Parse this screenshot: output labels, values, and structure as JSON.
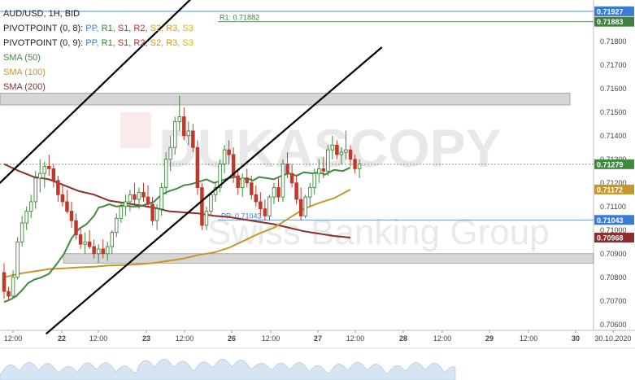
{
  "chart_data": {
    "type": "candlestick",
    "title": "AUD/USD, 1H, BID",
    "y_axis": {
      "ylim": [
        0.70575,
        0.71975
      ],
      "ticks": [
        "0.71800",
        "0.71700",
        "0.71600",
        "0.71500",
        "0.71400",
        "0.71300",
        "0.71200",
        "0.71100",
        "0.71000",
        "0.70900",
        "0.70800",
        "0.70700",
        "0.70600"
      ],
      "position": "right"
    },
    "x_axis": {
      "tick_labels": [
        "12:00",
        "22",
        "12:00",
        "23",
        "12:00",
        "26",
        "12:00",
        "27",
        "12:00",
        "28",
        "12:00",
        "29",
        "12:00",
        "30",
        "30.10.2020"
      ]
    },
    "legend": [
      {
        "text": "AUD/USD, 1H, BID",
        "color": "#222222"
      },
      {
        "prefix": "PIVOTPOINT (0, 8):",
        "items": [
          "PP",
          "R1",
          "S1",
          "R2",
          "S2",
          "R3",
          "S3"
        ],
        "colors": [
          "#3a7bd5",
          "#2e8b2e",
          "#c62828",
          "#c62828",
          "#d79a00",
          "#d79a00",
          "#e0b800"
        ]
      },
      {
        "prefix": "PIVOTPOINT (0, 9):",
        "items": [
          "PP",
          "R1",
          "S1",
          "R2",
          "S2",
          "R3",
          "S3"
        ],
        "colors": [
          "#3a7bd5",
          "#2e8b2e",
          "#c62828",
          "#c62828",
          "#d79a00",
          "#d79a00",
          "#e0b800"
        ]
      },
      {
        "text": "SMA (50)",
        "color": "#3f8a3f"
      },
      {
        "text": "SMA (100)",
        "color": "#c9962a"
      },
      {
        "text": "SMA (200)",
        "color": "#8e2d2d"
      }
    ],
    "levels": [
      {
        "name": "R1",
        "label": "R1: 0.71882",
        "value": 0.71883,
        "badge": "0.71883",
        "color": "#3f7f3f"
      },
      {
        "name": "top",
        "value": 0.71927,
        "badge": "0.71927",
        "color": "#3a7bd5"
      },
      {
        "name": "PP",
        "label": "PP: 0.71043",
        "value": 0.71043,
        "badge": "0.71043",
        "color": "#3a7bd5"
      }
    ],
    "last_price": {
      "value": 0.71279,
      "badge": "0.71279",
      "color": "#3f8a3f"
    },
    "sma100_last": {
      "value": 0.71172,
      "badge": "0.71172",
      "color": "#c9962a"
    },
    "sma200_last": {
      "value": 0.70968,
      "badge": "0.70968",
      "color": "#8e2d2d"
    },
    "zones": [
      {
        "from": 0.7153,
        "to": 0.7158,
        "color": "#cfcfcf"
      },
      {
        "from": 0.7086,
        "to": 0.709,
        "color": "#cfcfcf"
      }
    ],
    "trendlines": [
      {
        "from": [
          -6,
          0.7118
        ],
        "to": [
          128,
          0.72
        ]
      },
      {
        "from": [
          28,
          0.7056
        ],
        "to": [
          252,
          0.71775
        ]
      }
    ],
    "sma50": [
      [
        0,
        0.70695
      ],
      [
        4,
        0.70705
      ],
      [
        8,
        0.7072
      ],
      [
        12,
        0.70745
      ],
      [
        16,
        0.70775
      ],
      [
        20,
        0.7079
      ],
      [
        25,
        0.708
      ],
      [
        30,
        0.70815
      ],
      [
        35,
        0.70855
      ],
      [
        40,
        0.709
      ],
      [
        45,
        0.70965
      ],
      [
        50,
        0.71005
      ],
      [
        55,
        0.71025
      ],
      [
        60,
        0.7106
      ],
      [
        63,
        0.71095
      ],
      [
        66,
        0.711
      ],
      [
        70,
        0.7111
      ],
      [
        75,
        0.711
      ],
      [
        80,
        0.71105
      ],
      [
        85,
        0.711
      ],
      [
        90,
        0.711
      ],
      [
        95,
        0.7111
      ],
      [
        100,
        0.7112
      ],
      [
        105,
        0.7115
      ],
      [
        110,
        0.71165
      ],
      [
        115,
        0.71175
      ],
      [
        120,
        0.7119
      ],
      [
        125,
        0.71195
      ],
      [
        130,
        0.71205
      ],
      [
        135,
        0.71215
      ],
      [
        140,
        0.712
      ],
      [
        145,
        0.7121
      ],
      [
        150,
        0.7122
      ],
      [
        154,
        0.71225
      ],
      [
        158,
        0.71215
      ],
      [
        162,
        0.7122
      ],
      [
        166,
        0.7121
      ],
      [
        170,
        0.71225
      ],
      [
        175,
        0.7122
      ],
      [
        180,
        0.71215
      ],
      [
        185,
        0.7123
      ],
      [
        190,
        0.7124
      ],
      [
        195,
        0.7123
      ],
      [
        200,
        0.71245
      ],
      [
        206,
        0.7124
      ],
      [
        210,
        0.71245
      ],
      [
        214,
        0.71235
      ],
      [
        220,
        0.71255
      ],
      [
        226,
        0.7125
      ],
      [
        231,
        0.71265
      ]
    ],
    "sma100": [
      [
        0,
        0.708
      ],
      [
        10,
        0.70815
      ],
      [
        20,
        0.70825
      ],
      [
        30,
        0.70835
      ],
      [
        40,
        0.70838
      ],
      [
        50,
        0.70842
      ],
      [
        60,
        0.70845
      ],
      [
        70,
        0.7085
      ],
      [
        80,
        0.70852
      ],
      [
        90,
        0.70855
      ],
      [
        100,
        0.7086
      ],
      [
        110,
        0.7087
      ],
      [
        120,
        0.7088
      ],
      [
        130,
        0.70895
      ],
      [
        140,
        0.70905
      ],
      [
        150,
        0.70925
      ],
      [
        160,
        0.70955
      ],
      [
        170,
        0.70985
      ],
      [
        180,
        0.7101
      ],
      [
        190,
        0.7105
      ],
      [
        200,
        0.7109
      ],
      [
        210,
        0.71115
      ],
      [
        220,
        0.71135
      ],
      [
        231,
        0.71172
      ]
    ],
    "sma200": [
      [
        0,
        0.7128
      ],
      [
        10,
        0.7125
      ],
      [
        20,
        0.71225
      ],
      [
        30,
        0.71215
      ],
      [
        40,
        0.7119
      ],
      [
        50,
        0.71165
      ],
      [
        60,
        0.7115
      ],
      [
        70,
        0.71125
      ],
      [
        80,
        0.71115
      ],
      [
        90,
        0.71105
      ],
      [
        100,
        0.71095
      ],
      [
        110,
        0.7108
      ],
      [
        120,
        0.71075
      ],
      [
        130,
        0.7107
      ],
      [
        140,
        0.7106
      ],
      [
        150,
        0.71055
      ],
      [
        160,
        0.71045
      ],
      [
        170,
        0.71035
      ],
      [
        180,
        0.71025
      ],
      [
        190,
        0.7101
      ],
      [
        200,
        0.70995
      ],
      [
        210,
        0.70985
      ],
      [
        220,
        0.70975
      ],
      [
        231,
        0.70968
      ]
    ],
    "candles": [
      [
        0.7082,
        0.7086,
        0.7071,
        0.7074
      ],
      [
        0.7074,
        0.7076,
        0.707,
        0.7072
      ],
      [
        0.7072,
        0.7083,
        0.7071,
        0.708
      ],
      [
        0.708,
        0.7097,
        0.7079,
        0.7095
      ],
      [
        0.7095,
        0.7106,
        0.7093,
        0.7103
      ],
      [
        0.7103,
        0.711,
        0.71,
        0.7108
      ],
      [
        0.7108,
        0.7115,
        0.7105,
        0.7112
      ],
      [
        0.7112,
        0.7125,
        0.7109,
        0.7122
      ],
      [
        0.7122,
        0.713,
        0.7116,
        0.7124
      ],
      [
        0.7124,
        0.7129,
        0.7118,
        0.7127
      ],
      [
        0.7127,
        0.7132,
        0.7123,
        0.7126
      ],
      [
        0.7126,
        0.7128,
        0.7118,
        0.7121
      ],
      [
        0.7121,
        0.7123,
        0.7112,
        0.7115
      ],
      [
        0.7115,
        0.7119,
        0.711,
        0.7112
      ],
      [
        0.7112,
        0.7117,
        0.7107,
        0.7108
      ],
      [
        0.7108,
        0.7112,
        0.7101,
        0.7104
      ],
      [
        0.7104,
        0.7107,
        0.7096,
        0.7098
      ],
      [
        0.7098,
        0.7101,
        0.7092,
        0.7094
      ],
      [
        0.7094,
        0.7099,
        0.709,
        0.7095
      ],
      [
        0.7095,
        0.71,
        0.7092,
        0.7093
      ],
      [
        0.7093,
        0.7096,
        0.7088,
        0.709
      ],
      [
        0.709,
        0.7094,
        0.7086,
        0.7092
      ],
      [
        0.7092,
        0.7096,
        0.7088,
        0.709
      ],
      [
        0.709,
        0.7095,
        0.7087,
        0.7093
      ],
      [
        0.7093,
        0.71,
        0.709,
        0.7099
      ],
      [
        0.7099,
        0.7107,
        0.7097,
        0.7105
      ],
      [
        0.7105,
        0.7112,
        0.7103,
        0.711
      ],
      [
        0.711,
        0.7115,
        0.7106,
        0.7112
      ],
      [
        0.7112,
        0.7117,
        0.7108,
        0.7115
      ],
      [
        0.7115,
        0.712,
        0.7111,
        0.7113
      ],
      [
        0.7113,
        0.7118,
        0.7109,
        0.7116
      ],
      [
        0.7116,
        0.712,
        0.7112,
        0.7114
      ],
      [
        0.7114,
        0.7119,
        0.711,
        0.7111
      ],
      [
        0.7111,
        0.7114,
        0.7102,
        0.7104
      ],
      [
        0.7104,
        0.7111,
        0.71,
        0.7109
      ],
      [
        0.7109,
        0.712,
        0.7106,
        0.7118
      ],
      [
        0.7118,
        0.7133,
        0.7115,
        0.713
      ],
      [
        0.713,
        0.714,
        0.7125,
        0.7135
      ],
      [
        0.7135,
        0.7148,
        0.7132,
        0.7146
      ],
      [
        0.7146,
        0.7157,
        0.7142,
        0.7148
      ],
      [
        0.7148,
        0.7152,
        0.7138,
        0.714
      ],
      [
        0.714,
        0.7146,
        0.7136,
        0.7142
      ],
      [
        0.7142,
        0.7145,
        0.7133,
        0.7135
      ],
      [
        0.7135,
        0.7138,
        0.7115,
        0.7118
      ],
      [
        0.7118,
        0.712,
        0.71,
        0.7102
      ],
      [
        0.7102,
        0.711,
        0.71,
        0.7108
      ],
      [
        0.7108,
        0.7116,
        0.7106,
        0.7115
      ],
      [
        0.7115,
        0.712,
        0.7112,
        0.7118
      ],
      [
        0.7118,
        0.713,
        0.7116,
        0.7128
      ],
      [
        0.7128,
        0.7136,
        0.7124,
        0.7134
      ],
      [
        0.7134,
        0.7138,
        0.7128,
        0.7132
      ],
      [
        0.7132,
        0.7135,
        0.712,
        0.7123
      ],
      [
        0.7123,
        0.7126,
        0.7115,
        0.7118
      ],
      [
        0.7118,
        0.7124,
        0.7114,
        0.7122
      ],
      [
        0.7122,
        0.7126,
        0.7118,
        0.712
      ],
      [
        0.712,
        0.7123,
        0.7113,
        0.7115
      ],
      [
        0.7115,
        0.7119,
        0.711,
        0.7112
      ],
      [
        0.7112,
        0.7116,
        0.7106,
        0.7109
      ],
      [
        0.7109,
        0.7113,
        0.7104,
        0.7106
      ],
      [
        0.7106,
        0.7115,
        0.7104,
        0.7114
      ],
      [
        0.7114,
        0.712,
        0.7111,
        0.7118
      ],
      [
        0.7118,
        0.7122,
        0.7112,
        0.7114
      ],
      [
        0.7114,
        0.713,
        0.7112,
        0.7128
      ],
      [
        0.7128,
        0.7133,
        0.7122,
        0.7124
      ],
      [
        0.7124,
        0.7128,
        0.7118,
        0.712
      ],
      [
        0.712,
        0.7123,
        0.7111,
        0.7113
      ],
      [
        0.7113,
        0.7118,
        0.7104,
        0.7106
      ],
      [
        0.7106,
        0.7115,
        0.7105,
        0.7114
      ],
      [
        0.7114,
        0.712,
        0.711,
        0.7118
      ],
      [
        0.7118,
        0.7126,
        0.7115,
        0.7124
      ],
      [
        0.7124,
        0.713,
        0.712,
        0.7126
      ],
      [
        0.7126,
        0.7131,
        0.7122,
        0.7125
      ],
      [
        0.7125,
        0.7136,
        0.7123,
        0.7134
      ],
      [
        0.7134,
        0.714,
        0.713,
        0.7136
      ],
      [
        0.7136,
        0.7138,
        0.713,
        0.7132
      ],
      [
        0.7132,
        0.7135,
        0.7128,
        0.7133
      ],
      [
        0.7133,
        0.7142,
        0.713,
        0.7134
      ],
      [
        0.7134,
        0.7136,
        0.7127,
        0.713
      ],
      [
        0.713,
        0.7132,
        0.7124,
        0.7126
      ],
      [
        0.7126,
        0.713,
        0.7122,
        0.7128
      ]
    ]
  }
}
